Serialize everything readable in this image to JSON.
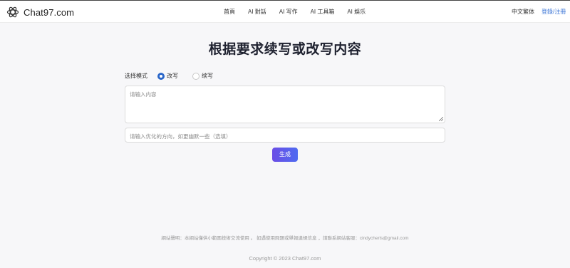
{
  "header": {
    "brand": "Chat97.com",
    "nav": [
      "首頁",
      "AI 對話",
      "AI 写作",
      "AI 工具箱",
      "AI 娛乐"
    ],
    "language": "中文繁体",
    "login": "登錄/注冊"
  },
  "main": {
    "title": "根据要求续写或改写内容",
    "mode": {
      "label": "选择模式",
      "options": [
        {
          "label": "改写",
          "selected": true
        },
        {
          "label": "续写",
          "selected": false
        }
      ]
    },
    "content_placeholder": "请输入内容",
    "direction_placeholder": "请输入优化的方向，如更幽默一些（选填）",
    "generate": "生成"
  },
  "footer": {
    "disclaimer": "網站聲明：本網站僅供小範圍技術交流使用 。 如遇使用問題或舉報違規信息 ，請聯系網站客服：cindycherls@gmail.com",
    "copyright": "Copyright © 2023 Chat97.com"
  },
  "colors": {
    "accent": "#2a66c9",
    "link": "#3a74d6",
    "button_start": "#6b4de6",
    "button_end": "#4f6bf0"
  }
}
